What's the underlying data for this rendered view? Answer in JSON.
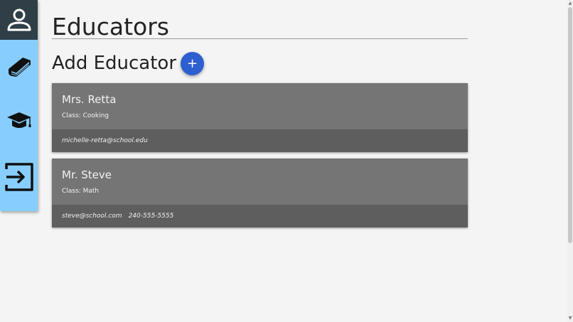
{
  "page": {
    "title": "Educators",
    "add_label": "Add Educator",
    "add_button_label": "+"
  },
  "sidebar": {
    "items": [
      {
        "icon": "user-icon"
      },
      {
        "icon": "book-icon"
      },
      {
        "icon": "graduation-cap-icon"
      },
      {
        "icon": "sign-in-icon"
      }
    ]
  },
  "educators": [
    {
      "name": "Mrs. Retta",
      "class_line": "Class: Cooking",
      "email": "michelle-retta@school.edu",
      "phone": ""
    },
    {
      "name": "Mr. Steve",
      "class_line": "Class: Math",
      "email": "steve@school.com",
      "phone": "240-555-5555"
    }
  ],
  "colors": {
    "sidebar": "#87ceff",
    "sidebar_top": "#2f3e47",
    "card": "#757575",
    "card_footer": "#5e5e5e",
    "accent": "#2d5fd0"
  },
  "scrollbar": {
    "up": "▲",
    "down": "▼"
  }
}
